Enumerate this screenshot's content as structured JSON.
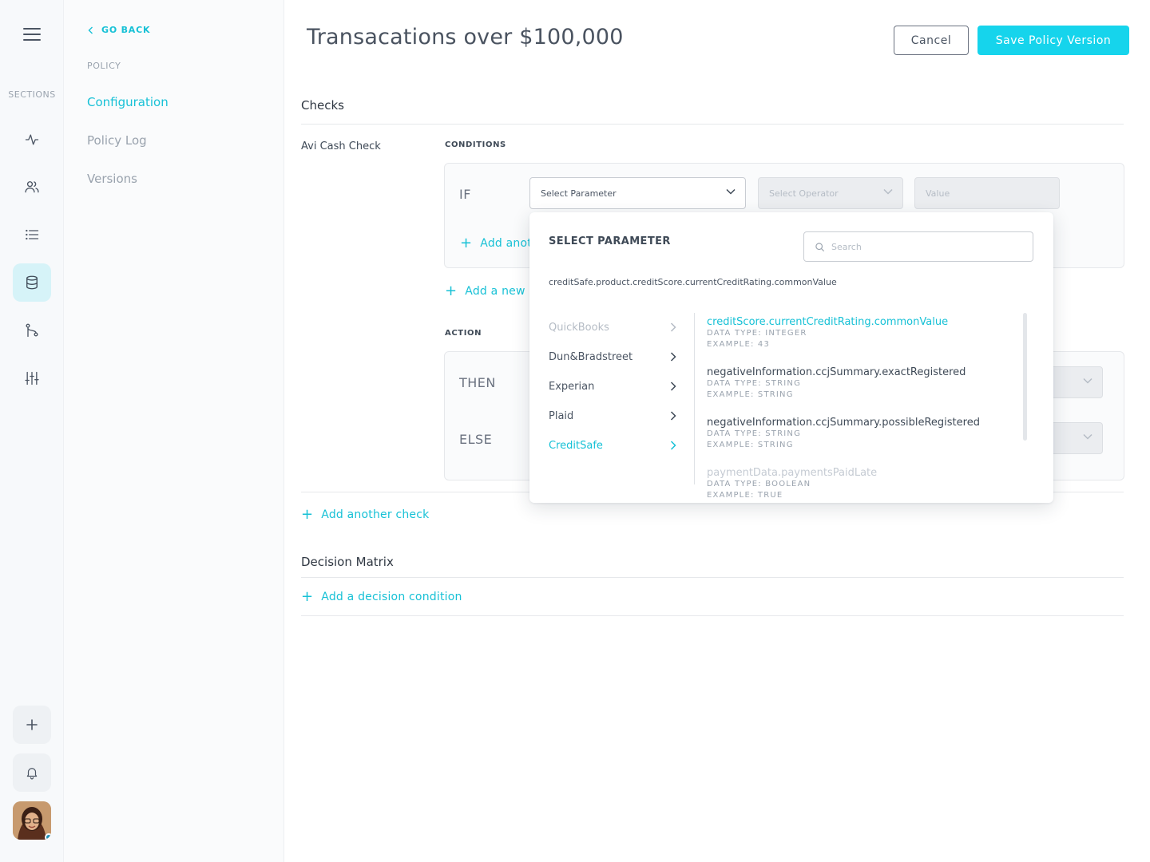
{
  "rail": {
    "sections_label": "SECTIONS",
    "icons": [
      "activity-icon",
      "users-icon",
      "list-icon",
      "database-icon",
      "git-branch-icon",
      "sliders-icon"
    ],
    "active_icon": "database-icon"
  },
  "sidebar": {
    "go_back": "GO BACK",
    "policy_label": "POLICY",
    "items": [
      {
        "label": "Configuration"
      },
      {
        "label": "Policy Log"
      },
      {
        "label": "Versions"
      }
    ],
    "active": "Configuration"
  },
  "header": {
    "title": "Transacations over $100,000",
    "cancel_label": "Cancel",
    "save_label": "Save Policy Version"
  },
  "checks": {
    "section_title": "Checks",
    "check_name": "Avi Cash Check",
    "conditions_label": "CONDITIONS",
    "if_keyword": "IF",
    "parameter_placeholder": "Select Parameter",
    "operator_placeholder": "Select Operator",
    "value_placeholder": "Value",
    "add_another_condition": "Add anot",
    "add_new_group": "Add a new c",
    "action_label": "ACTION",
    "then_keyword": "THEN",
    "else_keyword": "ELSE",
    "add_another_check": "Add another check"
  },
  "decision_matrix": {
    "section_title": "Decision Matrix",
    "add_condition": "Add a decision condition"
  },
  "popover": {
    "title": "SELECT PARAMETER",
    "search_placeholder": "Search",
    "selected_path": "creditSafe.product.creditScore.currentCreditRating.commonValue",
    "providers": [
      {
        "label": "QuickBooks",
        "state": "muted"
      },
      {
        "label": "Dun&Bradstreet",
        "state": "normal"
      },
      {
        "label": "Experian",
        "state": "normal"
      },
      {
        "label": "Plaid",
        "state": "normal"
      },
      {
        "label": "CreditSafe",
        "state": "active"
      }
    ],
    "parameters": [
      {
        "name": "creditScore.currentCreditRating.commonValue",
        "data_type": "DATA TYPE: INTEGER",
        "example": "EXAMPLE: 43",
        "state": "active"
      },
      {
        "name": "negativeInformation.ccjSummary.exactRegistered",
        "data_type": "DATA TYPE: STRING",
        "example": "EXAMPLE: STRING",
        "state": "normal"
      },
      {
        "name": "negativeInformation.ccjSummary.possibleRegistered",
        "data_type": "DATA TYPE: STRING",
        "example": "EXAMPLE: STRING",
        "state": "normal"
      },
      {
        "name": "paymentData.paymentsPaidLate",
        "data_type": "DATA TYPE: BOOLEAN",
        "example": "EXAMPLE: TRUE",
        "state": "faded"
      }
    ]
  },
  "colors": {
    "accent": "#17c1d6",
    "save_button": "#16d4ec",
    "active_nav_bg": "#d6f3f8"
  }
}
